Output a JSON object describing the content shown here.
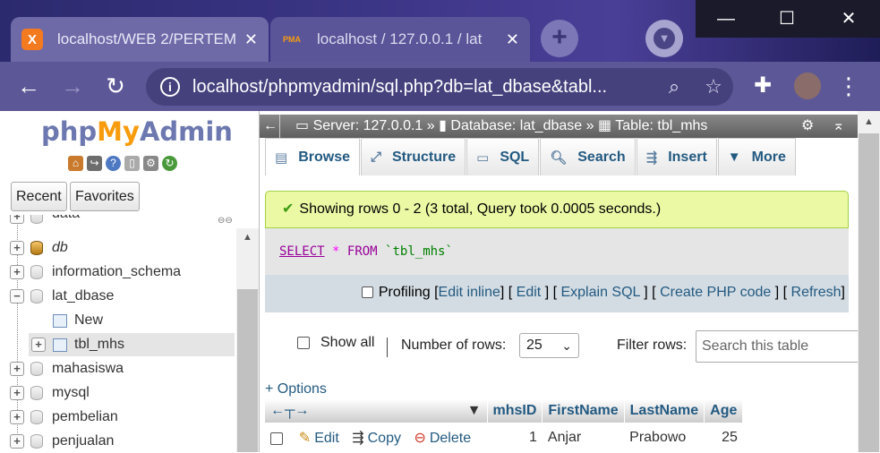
{
  "browser": {
    "tabs": [
      {
        "title": "localhost/WEB 2/PERTEM",
        "favicon": "X"
      },
      {
        "title": "localhost / 127.0.0.1 / lat",
        "favicon": "PMA"
      }
    ],
    "new_tab": "+",
    "url": "localhost/phpmyadmin/sql.php?db=lat_dbase&tabl...",
    "window_controls": {
      "minimize": "—",
      "maximize": "☐",
      "close": "✕"
    }
  },
  "sidebar": {
    "logo": {
      "php": "php",
      "my": "My",
      "admin": "Admin"
    },
    "buttons": {
      "recent": "Recent",
      "favorites": "Favorites"
    },
    "tree": [
      {
        "label": "data"
      },
      {
        "label": "db"
      },
      {
        "label": "information_schema"
      },
      {
        "label": "lat_dbase"
      },
      {
        "label": "New"
      },
      {
        "label": "tbl_mhs"
      },
      {
        "label": "mahasiswa"
      },
      {
        "label": "mysql"
      },
      {
        "label": "pembelian"
      },
      {
        "label": "penjualan"
      }
    ]
  },
  "breadcrumb": {
    "server": "Server: 127.0.0.1",
    "database": "Database: lat_dbase",
    "table": "Table: tbl_mhs"
  },
  "tabs": [
    {
      "label": "Browse"
    },
    {
      "label": "Structure"
    },
    {
      "label": "SQL"
    },
    {
      "label": "Search"
    },
    {
      "label": "Insert"
    },
    {
      "label": "More"
    }
  ],
  "result": {
    "message": "Showing rows 0 - 2 (3 total, Query took 0.0005 seconds.)",
    "sql": {
      "select": "SELECT",
      "star": "*",
      "from": "FROM",
      "table": "`tbl_mhs`"
    },
    "links": {
      "profiling": "Profiling",
      "edit_inline": "Edit inline",
      "edit": "Edit",
      "explain": "Explain SQL",
      "create_php": "Create PHP code",
      "refresh": "Refresh"
    }
  },
  "navigation": {
    "show_all": "Show all",
    "number_of_rows_label": "Number of rows:",
    "number_of_rows_value": "25",
    "filter_label": "Filter rows:",
    "filter_placeholder": "Search this table"
  },
  "options_link": "+ Options",
  "grid": {
    "columns": [
      "mhsID",
      "FirstName",
      "LastName",
      "Age"
    ],
    "actions": {
      "edit": "Edit",
      "copy": "Copy",
      "delete": "Delete"
    },
    "rows": [
      {
        "mhsID": "1",
        "FirstName": "Anjar",
        "LastName": "Prabowo",
        "Age": "25"
      }
    ]
  },
  "colors": {
    "accent": "#235a81",
    "success_bg": "#ebf8a4",
    "browser_bar": "#5c5796"
  }
}
